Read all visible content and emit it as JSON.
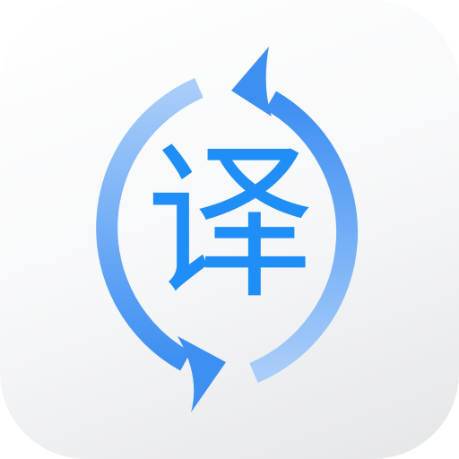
{
  "app_icon": {
    "glyph": "译",
    "colors": {
      "glyph": "#1f8ef7",
      "arrow_dark": "#3d8ff2",
      "arrow_light": "#a9cdf9",
      "tile_light": "#ffffff",
      "tile_dark": "#e5e6e8"
    },
    "icons": [
      "refresh-cycle-arrows-icon"
    ]
  }
}
